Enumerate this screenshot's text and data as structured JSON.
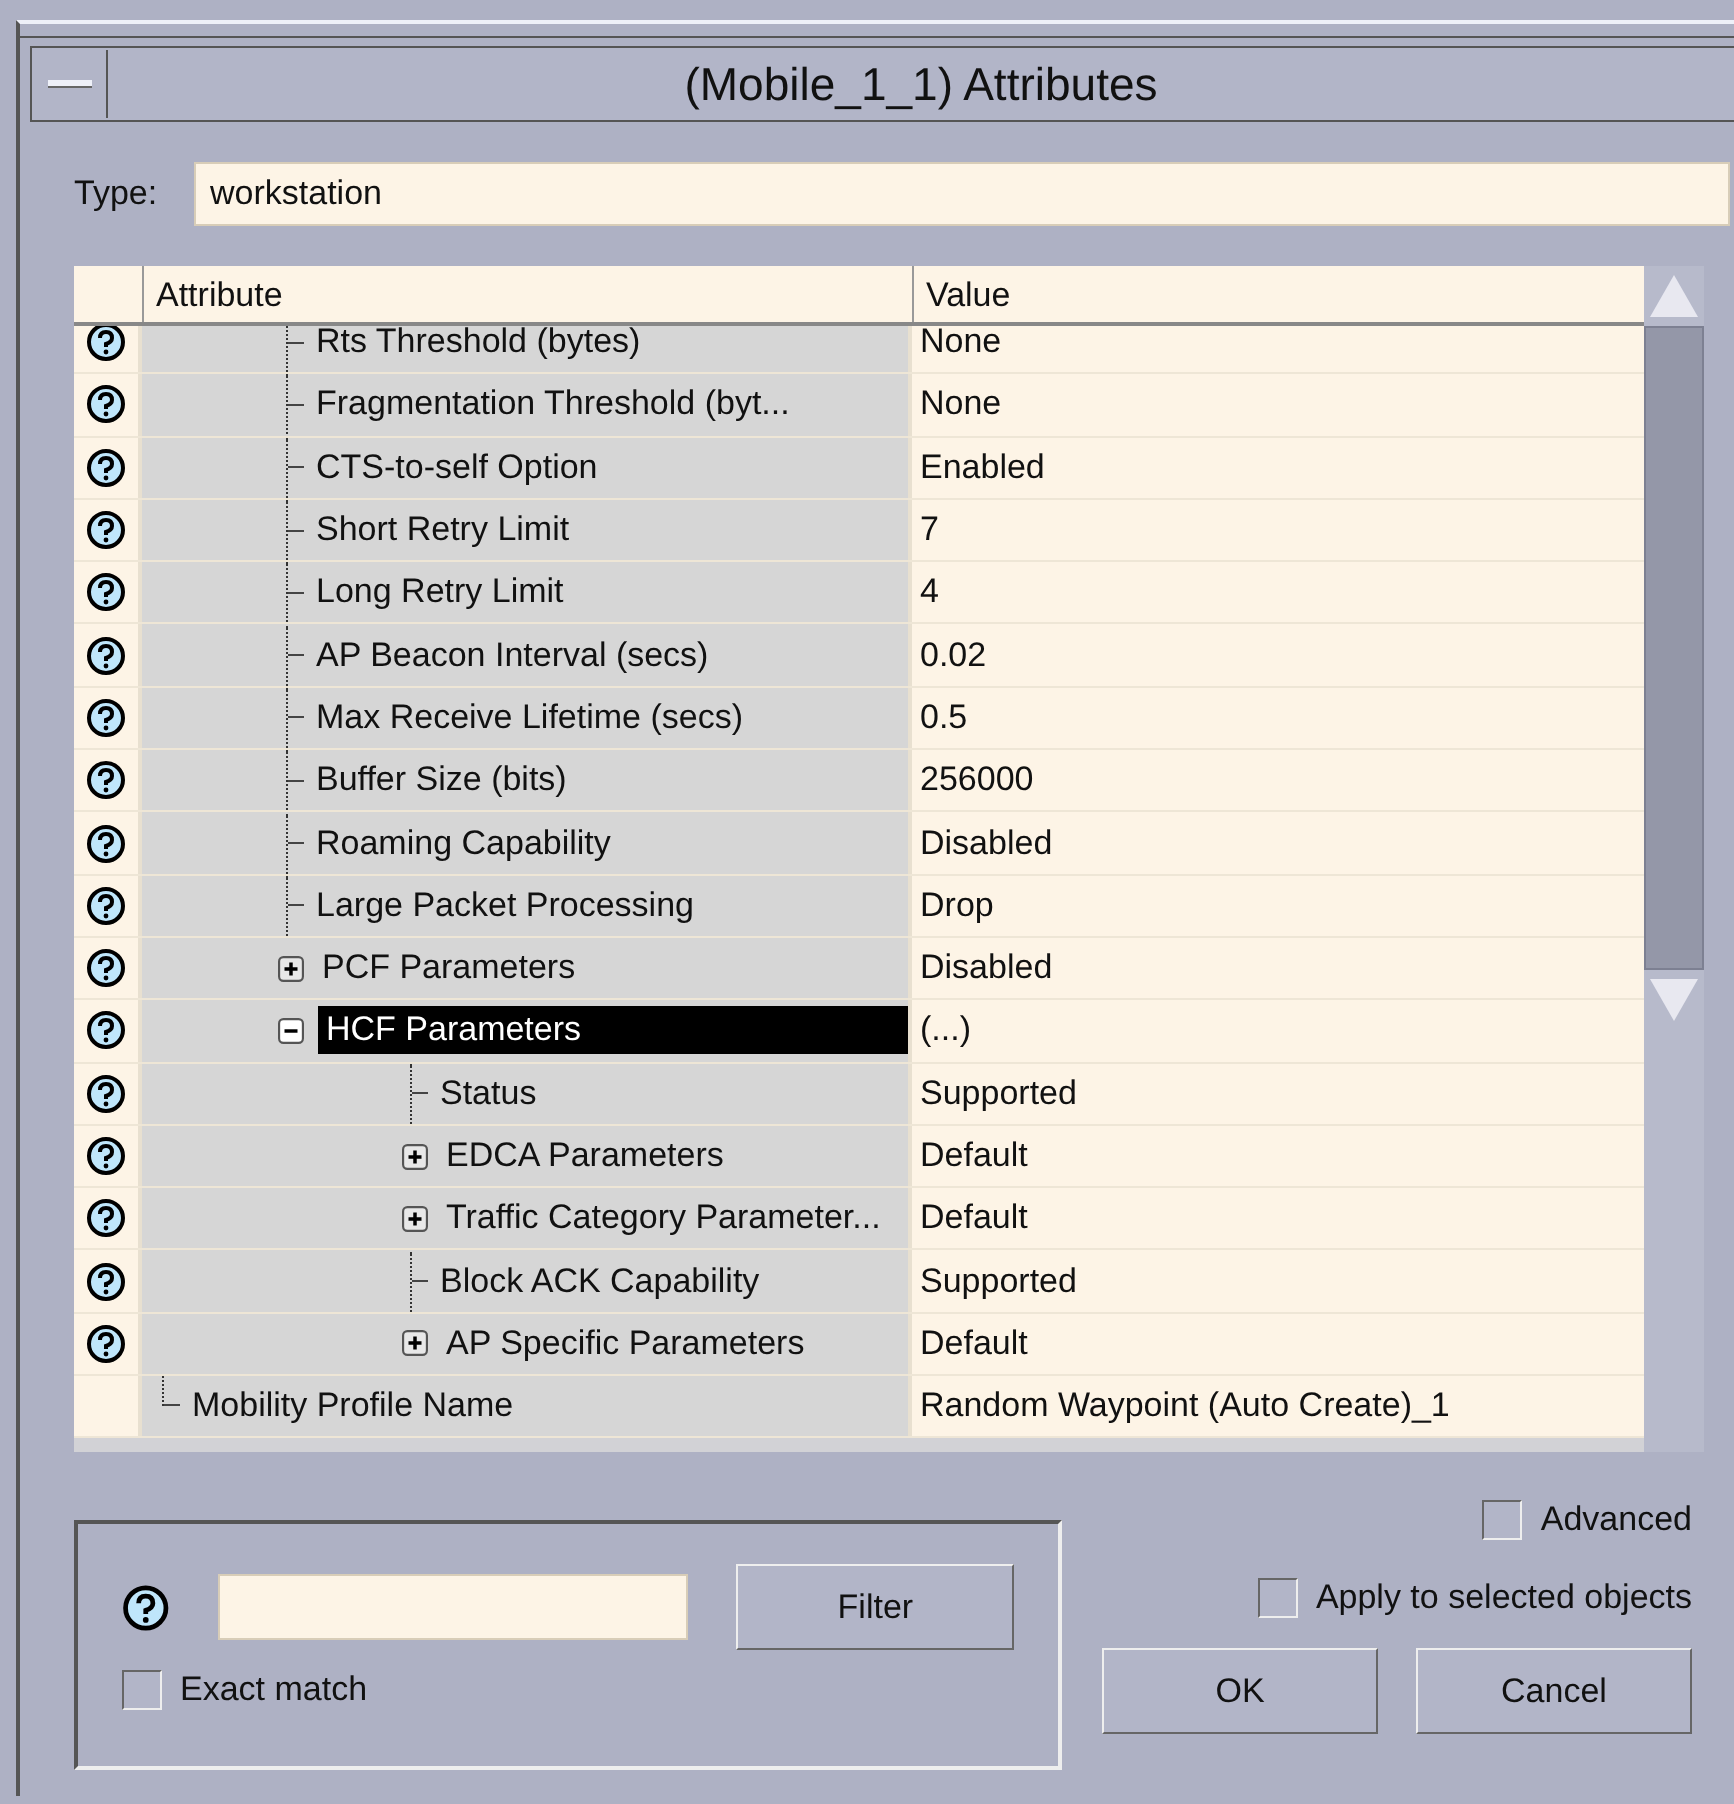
{
  "window": {
    "title": "(Mobile_1_1) Attributes"
  },
  "type": {
    "label": "Type:",
    "value": "workstation"
  },
  "table": {
    "columns": [
      "Attribute",
      "Value"
    ],
    "tree": [
      {
        "children": [
          {
            "attribute": "Rts Threshold (bytes)",
            "value": "None",
            "help": true,
            "selected": false
          },
          {
            "attribute": "Fragmentation Threshold (byt...",
            "value": "None",
            "help": true,
            "selected": false
          },
          {
            "attribute": "CTS-to-self Option",
            "value": "Enabled",
            "help": true,
            "selected": false
          },
          {
            "attribute": "Short Retry Limit",
            "value": "7",
            "help": true,
            "selected": false
          },
          {
            "attribute": "Long Retry Limit",
            "value": "4",
            "help": true,
            "selected": false
          },
          {
            "attribute": "AP Beacon Interval (secs)",
            "value": "0.02",
            "help": true,
            "selected": false
          },
          {
            "attribute": "Max Receive Lifetime (secs)",
            "value": "0.5",
            "help": true,
            "selected": false
          },
          {
            "attribute": "Buffer Size (bits)",
            "value": "256000",
            "help": true,
            "selected": false
          },
          {
            "attribute": "Roaming Capability",
            "value": "Disabled",
            "help": true,
            "selected": false
          },
          {
            "attribute": "Large Packet Processing",
            "value": "Drop",
            "help": true,
            "selected": false
          },
          {
            "attribute": "PCF Parameters",
            "value": "Disabled",
            "help": true,
            "selected": false,
            "expanded": false
          },
          {
            "attribute": "HCF Parameters",
            "value": "(...)",
            "help": true,
            "selected": true,
            "expanded": true,
            "children": [
              {
                "attribute": "Status",
                "value": "Supported",
                "help": true,
                "selected": false
              },
              {
                "attribute": "EDCA Parameters",
                "value": "Default",
                "help": true,
                "selected": false,
                "expanded": false
              },
              {
                "attribute": "Traffic Category Parameter...",
                "value": "Default",
                "help": true,
                "selected": false,
                "expanded": false
              },
              {
                "attribute": "Block ACK Capability",
                "value": "Supported",
                "help": true,
                "selected": false
              },
              {
                "attribute": "AP Specific Parameters",
                "value": "Default",
                "help": true,
                "selected": false,
                "expanded": false
              }
            ]
          }
        ]
      },
      {
        "attribute": "Mobility Profile Name",
        "value": "Random Waypoint (Auto Create)_1",
        "help": false,
        "selected": false
      }
    ]
  },
  "filter": {
    "button": {
      "label": "Filter"
    },
    "exact_match": {
      "label": "Exact match",
      "checked": false
    }
  },
  "advanced": {
    "label": "Advanced",
    "checked": false
  },
  "apply_selected": {
    "label": "Apply to selected objects",
    "checked": false
  },
  "buttons": [
    {
      "label": "OK"
    },
    {
      "label": "Cancel"
    }
  ]
}
